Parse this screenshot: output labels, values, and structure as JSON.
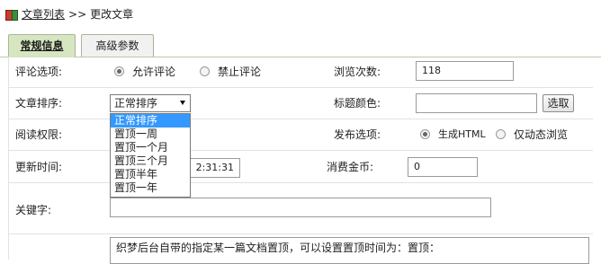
{
  "breadcrumb": {
    "root": "文章列表",
    "separator": ">>",
    "current": "更改文章"
  },
  "tabs": [
    {
      "label": "常规信息"
    },
    {
      "label": "高级参数"
    }
  ],
  "fields": {
    "comment": {
      "label": "评论选项:",
      "options": [
        "允许评论",
        "禁止评论"
      ],
      "selected": "允许评论"
    },
    "views": {
      "label": "浏览次数:",
      "value": "118"
    },
    "sort": {
      "label": "文章排序:",
      "selected": "正常排序",
      "options": [
        "正常排序",
        "置顶一周",
        "置顶一个月",
        "置顶三个月",
        "置顶半年",
        "置顶一年"
      ]
    },
    "title_color": {
      "label": "标题颜色:",
      "value": "",
      "button": "选取"
    },
    "read_permission": {
      "label": "阅读权限:"
    },
    "publish": {
      "label": "发布选项:",
      "options": [
        "生成HTML",
        "仅动态浏览"
      ],
      "selected": "生成HTML"
    },
    "update_time": {
      "label": "更新时间:",
      "value": "2:31:31"
    },
    "coins": {
      "label": "消费金币:",
      "value": "0"
    },
    "keywords": {
      "label": "关键字:",
      "value": ""
    },
    "description": {
      "value": "织梦后台自带的指定某一篇文档置顶，可以设置置顶时间为：置顶："
    }
  }
}
